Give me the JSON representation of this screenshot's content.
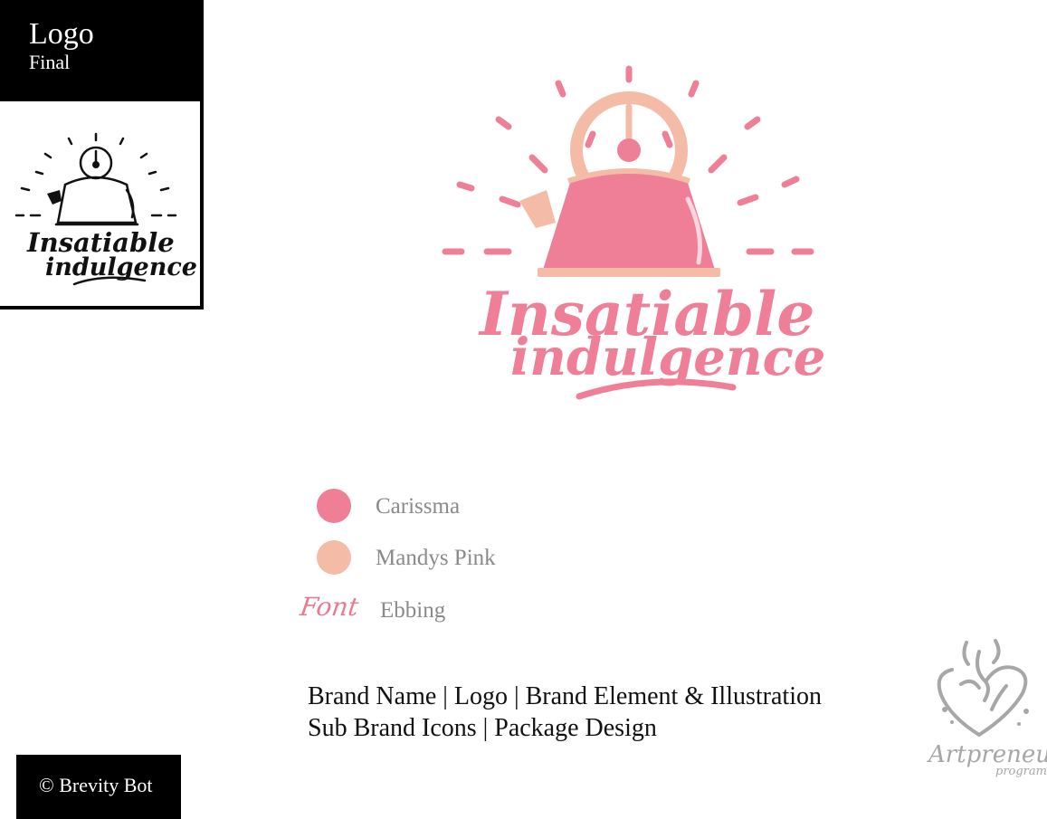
{
  "header": {
    "title": "Logo",
    "subtitle": "Final"
  },
  "logo": {
    "line1": "Insatiable",
    "line2": "indulgence"
  },
  "palette": [
    {
      "name": "Carissma",
      "color": "#ee7f97"
    },
    {
      "name": "Mandys Pink",
      "color": "#f4bca6"
    }
  ],
  "font": {
    "label": "Font",
    "name": "Ebbing"
  },
  "services": {
    "line1": "Brand Name | Logo |  Brand Element & Illustration",
    "line2": "Sub Brand Icons | Package Design"
  },
  "footer": {
    "copyright": "© Brevity Bot"
  },
  "watermark": {
    "text": "Artpreneur program"
  },
  "colors": {
    "accent": "#ee7f97",
    "secondary": "#f4bca6",
    "dark": "#000000",
    "muted": "#8a8a8a"
  }
}
